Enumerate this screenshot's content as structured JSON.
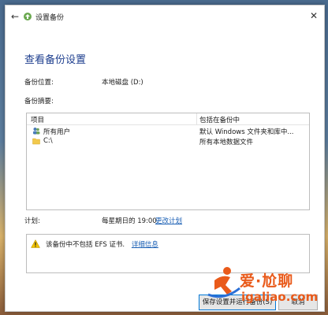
{
  "window": {
    "title": "设置备份"
  },
  "heading": "查看备份设置",
  "location": {
    "label": "备份位置:",
    "value": "本地磁盘 (D:)"
  },
  "summary": {
    "label": "备份摘要:"
  },
  "table": {
    "headers": [
      "项目",
      "包括在备份中"
    ],
    "rows": [
      {
        "name": "所有用户",
        "icon": "users-icon",
        "detail": "默认 Windows 文件夹和库中..."
      },
      {
        "name": "C:\\",
        "icon": "folder-icon",
        "detail": "所有本地数据文件"
      }
    ]
  },
  "schedule": {
    "label": "计划:",
    "value": "每星期日的 19:00",
    "link": "更改计划"
  },
  "warning": {
    "text": "该备份中不包括 EFS 证书.",
    "link": "详细信息"
  },
  "buttons": {
    "save": "保存设置并运行备份(S)",
    "cancel": "取消"
  },
  "watermark": {
    "brand": "爱·尬聊",
    "url": "igaliao.com"
  },
  "colors": {
    "heading": "#1e3f8f",
    "link": "#1a5fb4",
    "watermark": "#e95a1a",
    "warning": "#f2c200"
  }
}
